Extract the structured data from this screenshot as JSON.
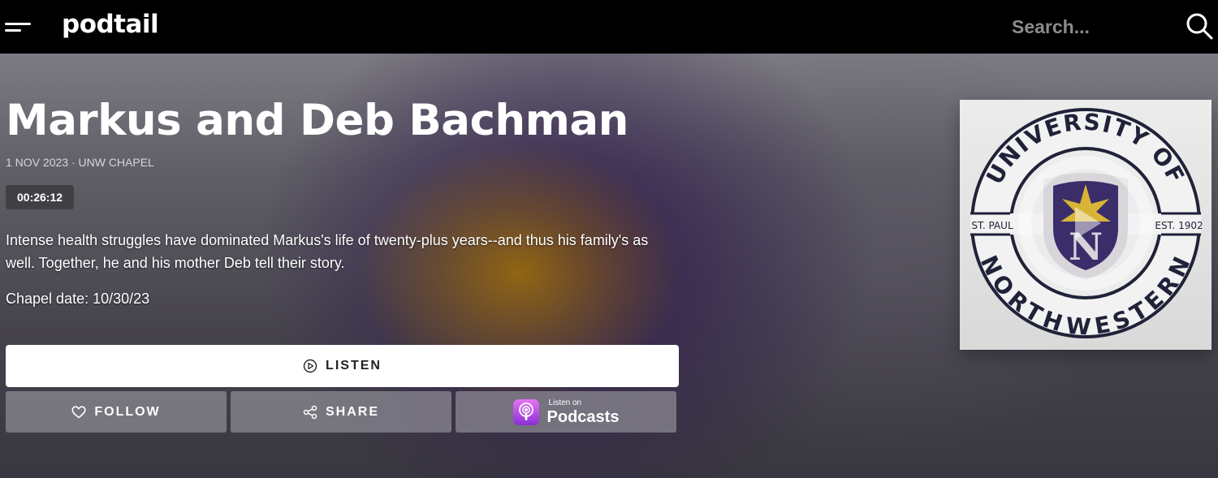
{
  "header": {
    "logo_text": "podtail",
    "search_placeholder": "Search..."
  },
  "episode": {
    "title": "Markus and Deb Bachman",
    "meta": "1 NOV 2023 · UNW CHAPEL",
    "duration": "00:26:12",
    "description": "Intense health struggles have dominated Markus's life of twenty-plus years--and thus his family's as well. Together, he and his mother Deb tell their story.",
    "chapel_date": "Chapel date: 10/30/23"
  },
  "actions": {
    "listen_label": "LISTEN",
    "follow_label": "FOLLOW",
    "share_label": "SHARE",
    "apple_small": "Listen on",
    "apple_big": "Podcasts"
  },
  "cover": {
    "top_text": "UNIVERSITY OF",
    "bottom_text": "NORTHWESTERN",
    "left_text": "ST. PAUL",
    "right_text": "EST. 1902",
    "colors": {
      "navy": "#1f2238",
      "gold": "#d8b437",
      "purple": "#3a2d6a"
    }
  },
  "icons": {
    "menu": "menu-icon",
    "search": "search-icon",
    "play": "play-circle-icon",
    "heart": "heart-icon",
    "share": "share-icon",
    "apple_podcasts": "apple-podcasts-icon"
  }
}
